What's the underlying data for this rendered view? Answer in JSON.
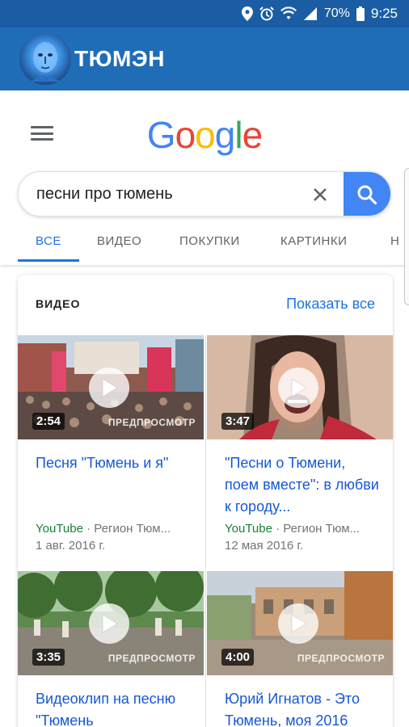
{
  "status_bar": {
    "battery": "70%",
    "time": "9:25"
  },
  "app_bar": {
    "title": "ТЮМЭН"
  },
  "google": {
    "logo_letters": [
      "G",
      "o",
      "o",
      "g",
      "l",
      "e"
    ]
  },
  "search": {
    "query": "песни про тюмень"
  },
  "tabs": [
    {
      "label": "ВСЕ",
      "active": true
    },
    {
      "label": "ВИДЕО",
      "active": false
    },
    {
      "label": "ПОКУПКИ",
      "active": false
    },
    {
      "label": "КАРТИНКИ",
      "active": false
    },
    {
      "label": "Н",
      "active": false
    }
  ],
  "video_card": {
    "title": "ВИДЕО",
    "show_all": "Показать все",
    "preview_label": "ПРЕДПРОСМОТР",
    "videos": [
      {
        "duration": "2:54",
        "title": "Песня \"Тюмень и я\"",
        "source": "YouTube",
        "channel": " · Регион Тюм...",
        "date": "1 авг. 2016 г."
      },
      {
        "duration": "3:47",
        "title": "\"Песни о Тюмени, поем вместе\": в любви к городу...",
        "source": "YouTube",
        "channel": " · Регион Тюм...",
        "date": "12 мая 2016 г."
      },
      {
        "duration": "3:35",
        "title": "Видеоклип на песню \"Тюмень",
        "preview": "ПРЕДПРОСМОТР"
      },
      {
        "duration": "4:00",
        "title": "Юрий Игнатов - Это Тюмень, моя 2016",
        "preview": "ПРЕДПРОСМОТР"
      }
    ]
  },
  "colors": {
    "status_bar": "#1a5da4",
    "app_bar": "#1f6db6",
    "link_blue": "#1558d6",
    "source_green": "#188038",
    "search_button": "#4285f4"
  }
}
